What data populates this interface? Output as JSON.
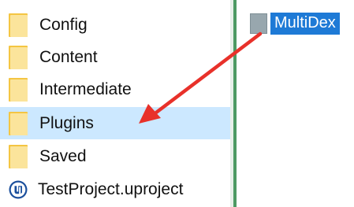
{
  "tree": {
    "items": [
      {
        "label": "Config",
        "icon": "folder-icon"
      },
      {
        "label": "Content",
        "icon": "folder-icon"
      },
      {
        "label": "Intermediate",
        "icon": "folder-icon"
      },
      {
        "label": "Plugins",
        "icon": "folder-icon",
        "selected": true
      },
      {
        "label": "Saved",
        "icon": "folder-icon"
      },
      {
        "label": "TestProject.uproject",
        "icon": "unreal-engine-icon"
      }
    ]
  },
  "drag": {
    "label": "MultiDex",
    "icon": "folder-icon"
  },
  "colors": {
    "selection": "#cce8ff",
    "drag_highlight": "#1e7ad6",
    "arrow": "#e8312a",
    "splitter": "#4d9a63"
  }
}
